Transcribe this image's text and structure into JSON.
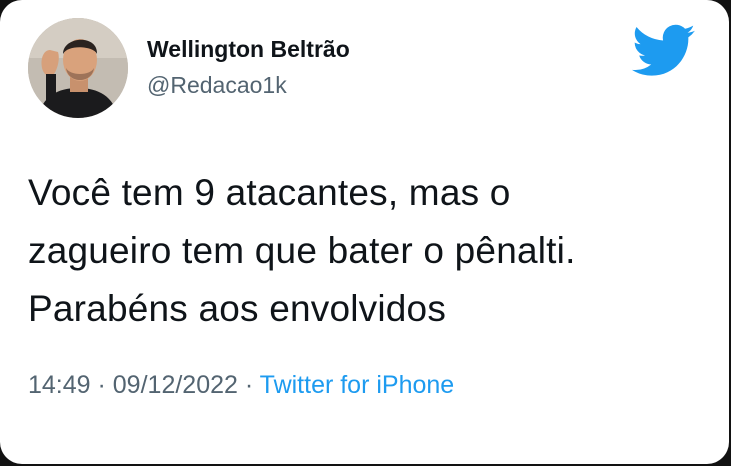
{
  "user": {
    "display_name": "Wellington Beltrão",
    "handle": "@Redacao1k"
  },
  "icons": {
    "brand": "twitter-bird-icon",
    "brand_color": "#1d9bf0"
  },
  "tweet": {
    "lines": [
      "Você tem 9 atacantes, mas o",
      "zagueiro tem que bater o pênalti.",
      "Parabéns aos envolvidos"
    ],
    "time": "14:49",
    "separator": " · ",
    "date": "09/12/2022",
    "source": "Twitter for iPhone"
  },
  "colors": {
    "text": "#0f1419",
    "secondary": "#536471",
    "link": "#1d9bf0"
  }
}
